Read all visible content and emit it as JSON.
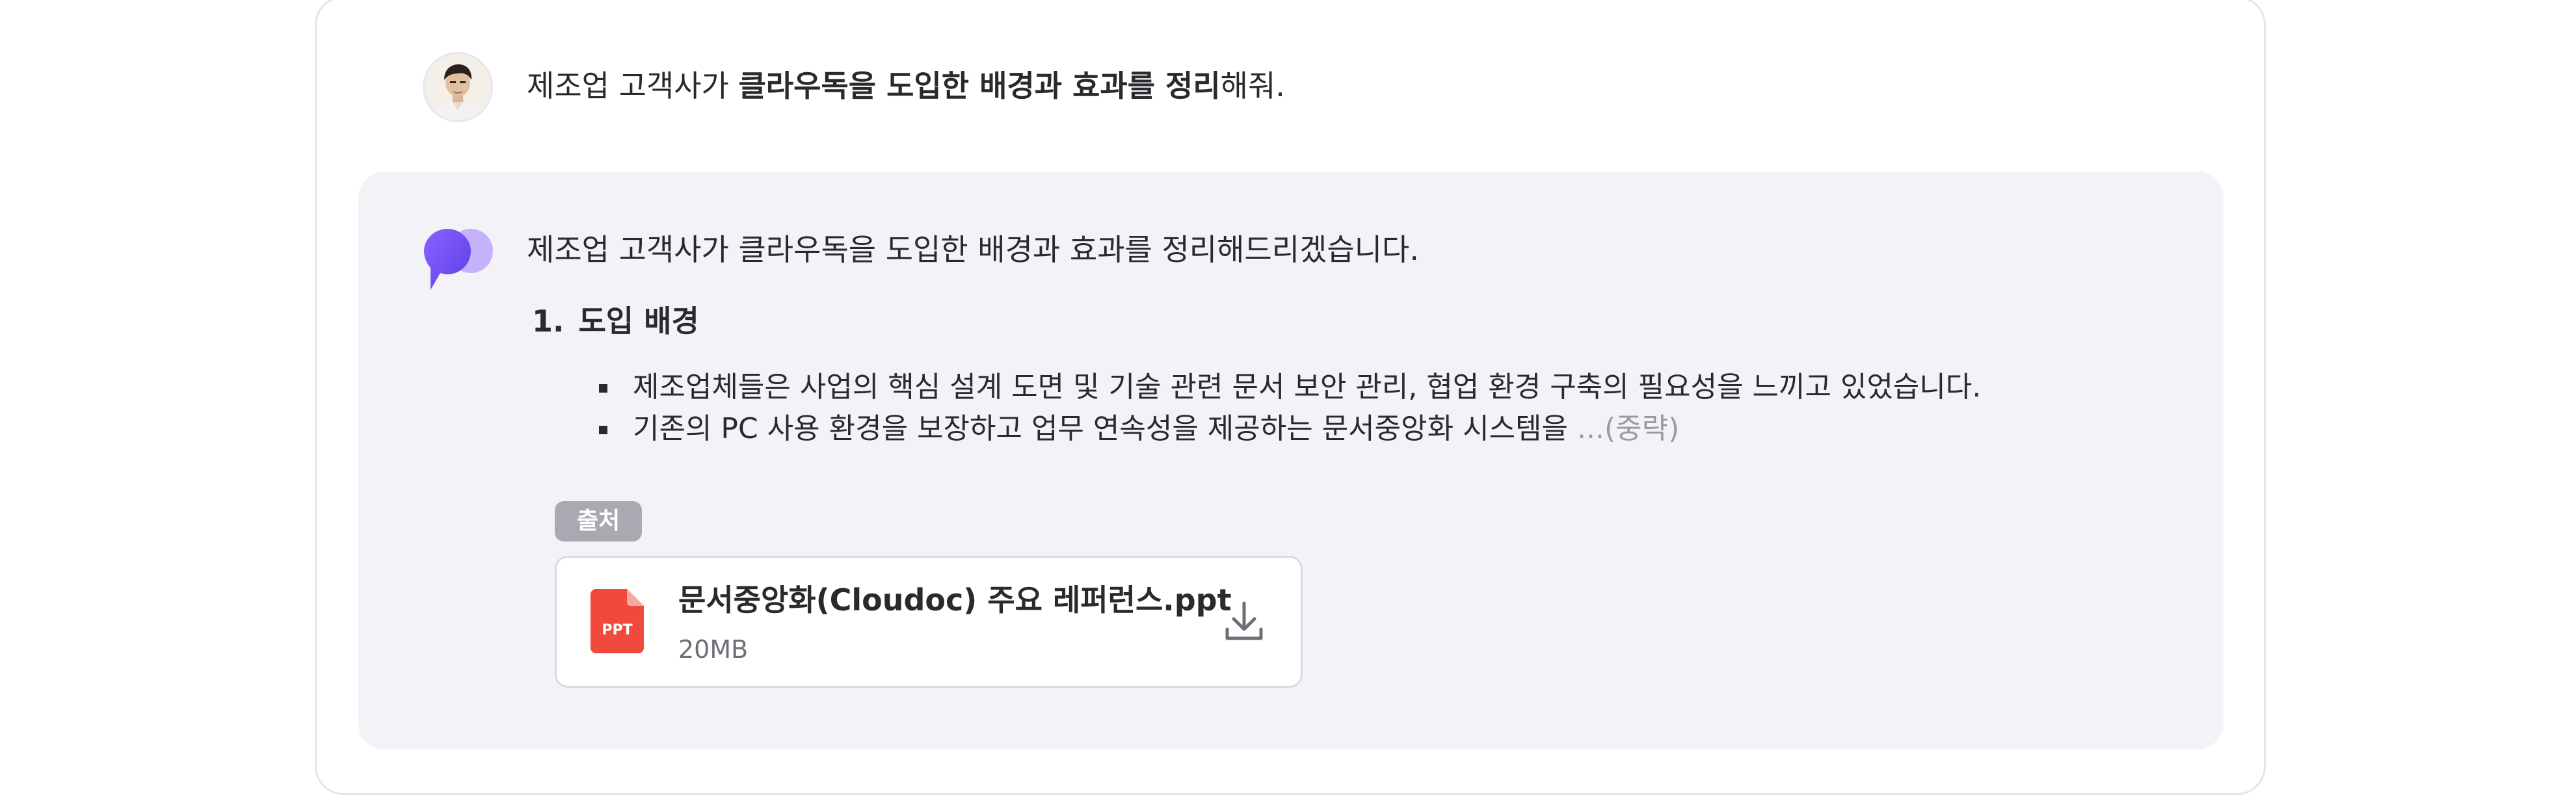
{
  "user": {
    "message_prefix": "제조업 고객사가 ",
    "message_bold": "클라우독을 도입한 배경과 효과를 정리",
    "message_suffix": "해줘."
  },
  "assistant": {
    "intro": "제조업 고객사가 클라우독을 도입한 배경과 효과를 정리해드리겠습니다.",
    "section_number": "1.",
    "section_title": "도입 배경",
    "bullets": [
      "제조업체들은 사업의 핵심 설계 도면 및 기술 관련 문서 보안 관리, 협업 환경 구축의 필요성을 느끼고 있었습니다.",
      "기존의 PC 사용 환경을 보장하고 업무 연속성을 제공하는 문서중앙화 시스템을 "
    ],
    "truncation": "...(중략)",
    "source_label": "출처",
    "file": {
      "type_label": "PPT",
      "name": "문서중앙화(Cloudoc) 주요 레퍼런스.ppt",
      "size": "20MB",
      "icon": "ppt-file-icon",
      "action_icon": "download-icon"
    }
  },
  "colors": {
    "panel_bg": "#f3f2f7",
    "badge_bg": "#a9a9b2",
    "ppt_red": "#ef4a3c",
    "logo_purple": "#7a55f5"
  }
}
